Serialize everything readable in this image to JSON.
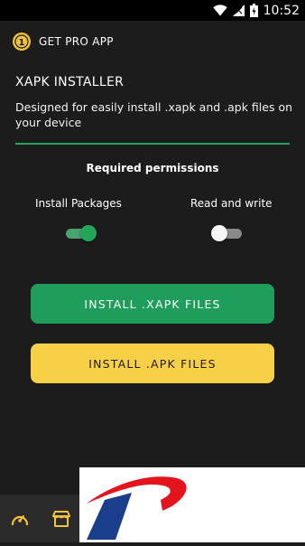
{
  "status_bar": {
    "time": "10:52",
    "icons": [
      "wifi-icon",
      "signal-icon",
      "battery-icon"
    ]
  },
  "pro_bar": {
    "icon": "coin-icon",
    "coin_text": "1",
    "label": "GET PRO APP"
  },
  "header": {
    "title": "XAPK INSTALLER",
    "description": "Designed for easily install .xapk and .apk files on your device"
  },
  "permissions": {
    "title": "Required permissions",
    "items": [
      {
        "label": "Install Packages",
        "enabled": true
      },
      {
        "label": "Read and write",
        "enabled": false
      }
    ]
  },
  "buttons": {
    "install_xapk": "INSTALL .XAPK FILES",
    "install_apk": "INSTALL .APK FILES"
  },
  "bottom_nav": {
    "items": [
      "speedometer-icon",
      "store-icon"
    ]
  },
  "colors": {
    "background": "#1c1c1c",
    "accent_green": "#23a55a",
    "button_green": "#1e9d5b",
    "button_yellow": "#f8d048",
    "coin_gold": "#f3c23b",
    "logo_red": "#e3141b",
    "logo_blue": "#1b3e8c"
  }
}
